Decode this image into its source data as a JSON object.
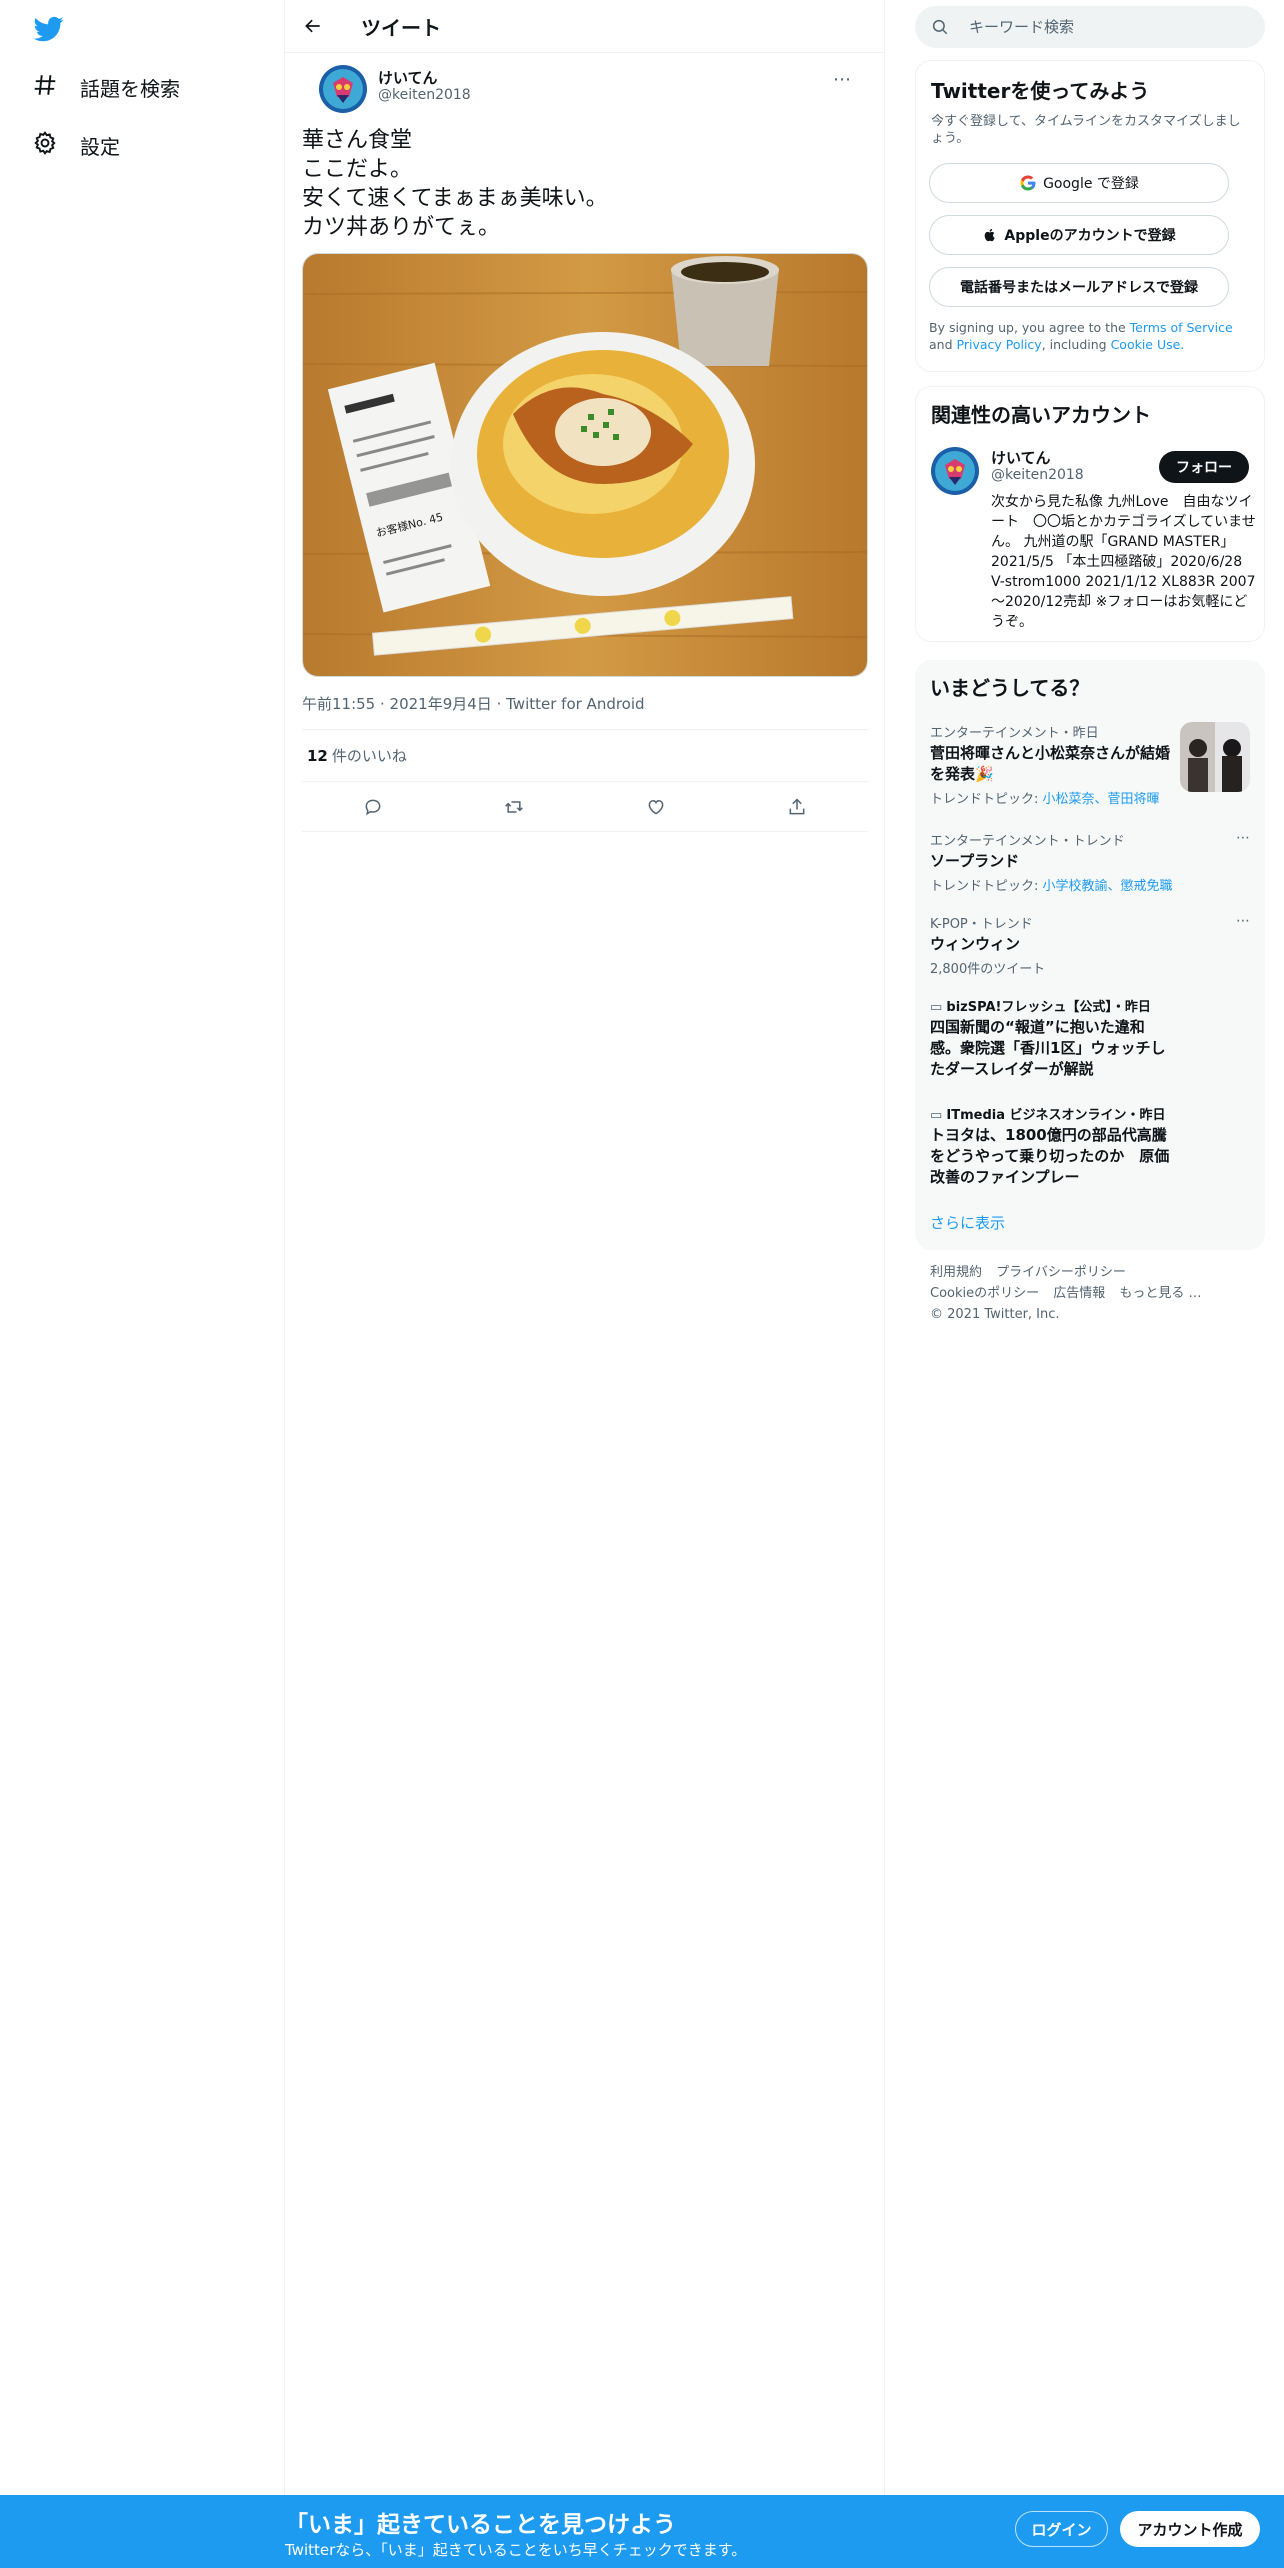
{
  "nav": {
    "items": [
      {
        "label": "話題を検索",
        "icon": "hashtag-icon"
      },
      {
        "label": "設定",
        "icon": "gear-icon"
      }
    ]
  },
  "header": {
    "title": "ツイート"
  },
  "tweet": {
    "author_name": "けいてん",
    "author_handle": "@keiten2018",
    "text": "華さん食堂\nここだよ。\n安くて速くてまぁまぁ美味い。\nカツ丼ありがてぇ。",
    "time": "午前11:55",
    "date": "2021年9月4日",
    "client": "Twitter for Android",
    "likes_count": "12",
    "likes_label": "件のいいね",
    "receipt_text": "お客様No. 45"
  },
  "search": {
    "placeholder": "キーワード検索"
  },
  "signup": {
    "title": "Twitterを使ってみよう",
    "subtitle": "今すぐ登録して、タイムラインをカスタマイズしましょう。",
    "google_label": "Google で登録",
    "apple_label": "Appleのアカウントで登録",
    "phone_label": "電話番号またはメールアドレスで登録",
    "terms_prefix": "By signing up, you agree to the",
    "terms_link": "Terms of Service",
    "terms_and": "and",
    "privacy_link": "Privacy Policy",
    "terms_including": ", including",
    "cookie_link": "Cookie Use."
  },
  "related": {
    "title": "関連性の高いアカウント",
    "name": "けいてん",
    "handle": "@keiten2018",
    "follow_label": "フォロー",
    "bio": "次女から見た私像 九州Love　自由なツイート　〇〇垢とかカテゴライズしていません。 九州道の駅「GRAND MASTER」2021/5/5 「本土四極踏破」2020/6/28 V-strom1000 2021/1/12 XL883R 2007～2020/12売却 ※フォローはお気軽にどうぞ。"
  },
  "trends": {
    "title": "いまどうしてる？",
    "items": [
      {
        "context": "エンターテインメント・昨日",
        "name": "菅田将暉さんと小松菜奈さんが結婚を発表🎉",
        "topic_prefix": "トレンドトピック:",
        "topic": "小松菜奈、菅田将暉"
      },
      {
        "context": "エンターテインメント・トレンド",
        "name": "ソープランド",
        "topic_prefix": "トレンドトピック:",
        "topic": "小学校教諭、懲戒免職"
      },
      {
        "context": "K-POP・トレンド",
        "name": "ウィンウィン",
        "count": "2,800件のツイート"
      },
      {
        "context": "bizSPA!フレッシュ【公式】・昨日",
        "name": "四国新聞の“報道”に抱いた違和感。衆院選「香川1区」ウォッチしたダースレイダーが解説"
      },
      {
        "context": "ITmedia ビジネスオンライン・昨日",
        "name": "トヨタは、1800億円の部品代高騰をどうやって乗り切ったのか　原価改善のファインプレー"
      }
    ],
    "show_more": "さらに表示"
  },
  "footer": {
    "links": [
      "利用規約",
      "プライバシーポリシー",
      "Cookieのポリシー",
      "広告情報",
      "もっと見る …"
    ],
    "copyright": "© 2021 Twitter, Inc."
  },
  "banner": {
    "title": "「いま」起きていることを見つけよう",
    "subtitle": "Twitterなら、「いま」起きていることをいち早くチェックできます。",
    "login_label": "ログイン",
    "signup_label": "アカウント作成"
  },
  "colors": {
    "accent": "#1d9bf0",
    "text": "#0f1419",
    "muted": "#536471"
  }
}
